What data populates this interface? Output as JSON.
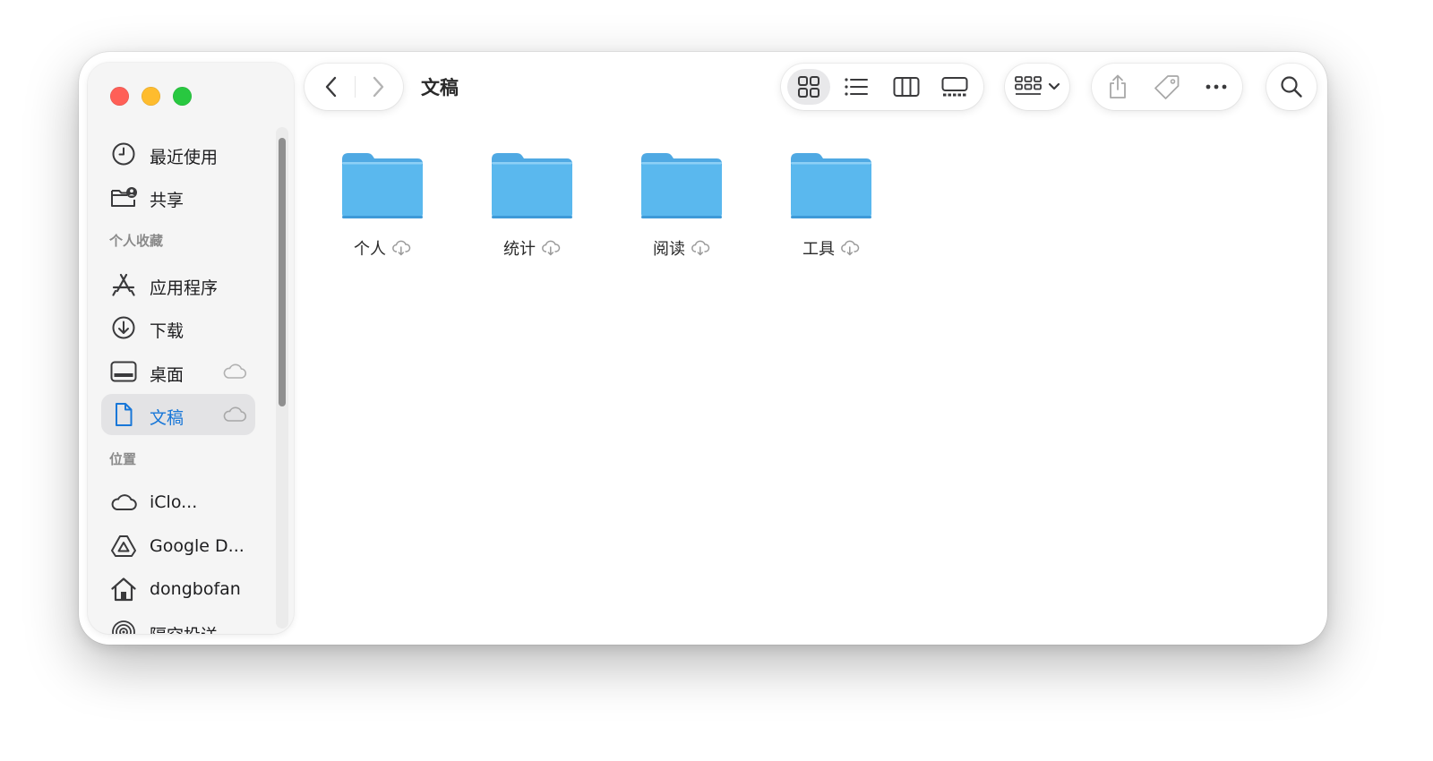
{
  "window": {
    "title": "文稿",
    "traffic_lights": {
      "close": "#ff5f57",
      "minimize": "#febc2e",
      "maximize": "#28c840"
    }
  },
  "sidebar": {
    "top_items": [
      {
        "label": "最近使用",
        "icon": "clock-icon"
      },
      {
        "label": "共享",
        "icon": "shared-folder-icon"
      }
    ],
    "favorites_header": "个人收藏",
    "favorites": [
      {
        "label": "应用程序",
        "icon": "app-store-icon"
      },
      {
        "label": "下载",
        "icon": "download-icon"
      },
      {
        "label": "桌面",
        "icon": "desktop-icon",
        "cloud": true
      },
      {
        "label": "文稿",
        "icon": "document-icon",
        "cloud": true,
        "selected": true
      }
    ],
    "locations_header": "位置",
    "locations": [
      {
        "label": "iClo...",
        "icon": "icloud-icon"
      },
      {
        "label": "Google D...",
        "icon": "google-drive-icon"
      },
      {
        "label": "dongbofan",
        "icon": "home-icon"
      },
      {
        "label": "隔空投送",
        "icon": "airdrop-icon"
      }
    ],
    "accent": "#1877d8"
  },
  "toolbar": {
    "view_modes": [
      "icon-view-icon",
      "list-view-icon",
      "column-view-icon",
      "gallery-view-icon"
    ],
    "active_view": "icon-view-icon",
    "group_icon": "group-by-icon",
    "actions": [
      "share-icon",
      "tag-icon",
      "more-icon"
    ],
    "search_icon": "search-icon"
  },
  "content": {
    "folders": [
      {
        "label": "个人"
      },
      {
        "label": "统计"
      },
      {
        "label": "阅读"
      },
      {
        "label": "工具"
      }
    ],
    "folder_color": "#5ab8ee"
  }
}
